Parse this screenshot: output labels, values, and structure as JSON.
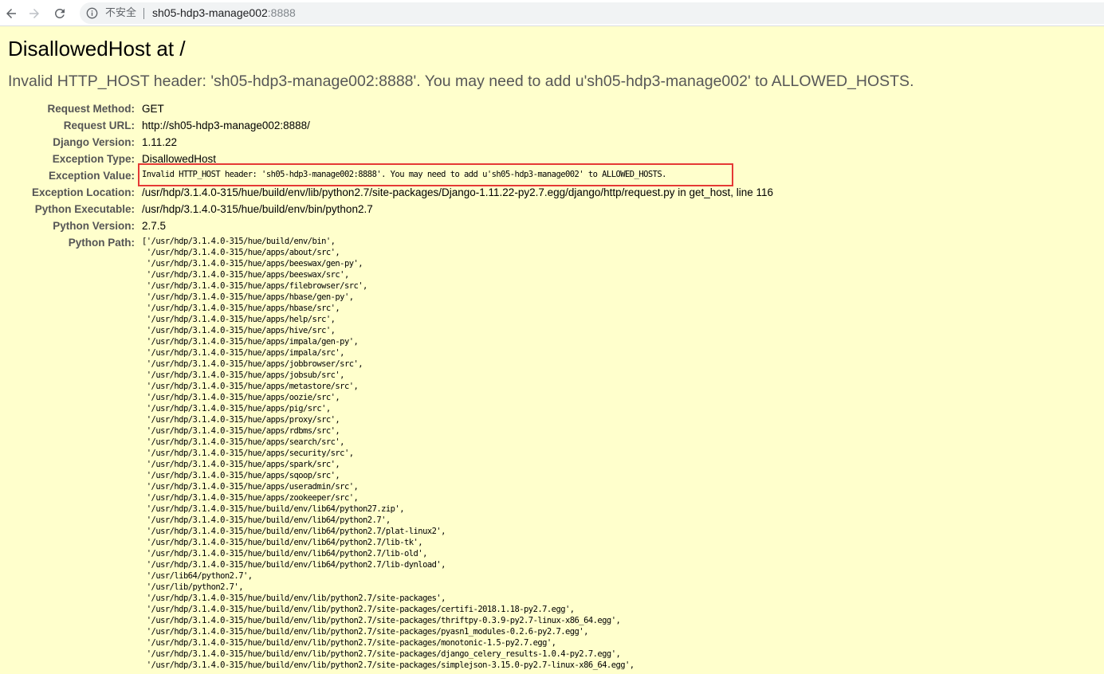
{
  "browser": {
    "insecure_label": "不安全",
    "url_host": "sh05-hdp3-manage002",
    "url_port": ":8888"
  },
  "error": {
    "title": "DisallowedHost at /",
    "subtitle": "Invalid HTTP_HOST header: 'sh05-hdp3-manage002:8888'. You may need to add u'sh05-hdp3-manage002' to ALLOWED_HOSTS."
  },
  "meta": [
    {
      "label": "Request Method:",
      "value": "GET"
    },
    {
      "label": "Request URL:",
      "value": "http://sh05-hdp3-manage002:8888/"
    },
    {
      "label": "Django Version:",
      "value": "1.11.22"
    },
    {
      "label": "Exception Type:",
      "value": "DisallowedHost"
    },
    {
      "label": "Exception Value:",
      "value": "Invalid HTTP_HOST header: 'sh05-hdp3-manage002:8888'. You may need to add u'sh05-hdp3-manage002' to ALLOWED_HOSTS."
    },
    {
      "label": "Exception Location:",
      "value": "/usr/hdp/3.1.4.0-315/hue/build/env/lib/python2.7/site-packages/Django-1.11.22-py2.7.egg/django/http/request.py in get_host, line 116"
    },
    {
      "label": "Python Executable:",
      "value": "/usr/hdp/3.1.4.0-315/hue/build/env/bin/python2.7"
    },
    {
      "label": "Python Version:",
      "value": "2.7.5"
    },
    {
      "label": "Python Path:",
      "value": ""
    }
  ],
  "python_path": [
    "['/usr/hdp/3.1.4.0-315/hue/build/env/bin',",
    " '/usr/hdp/3.1.4.0-315/hue/apps/about/src',",
    " '/usr/hdp/3.1.4.0-315/hue/apps/beeswax/gen-py',",
    " '/usr/hdp/3.1.4.0-315/hue/apps/beeswax/src',",
    " '/usr/hdp/3.1.4.0-315/hue/apps/filebrowser/src',",
    " '/usr/hdp/3.1.4.0-315/hue/apps/hbase/gen-py',",
    " '/usr/hdp/3.1.4.0-315/hue/apps/hbase/src',",
    " '/usr/hdp/3.1.4.0-315/hue/apps/help/src',",
    " '/usr/hdp/3.1.4.0-315/hue/apps/hive/src',",
    " '/usr/hdp/3.1.4.0-315/hue/apps/impala/gen-py',",
    " '/usr/hdp/3.1.4.0-315/hue/apps/impala/src',",
    " '/usr/hdp/3.1.4.0-315/hue/apps/jobbrowser/src',",
    " '/usr/hdp/3.1.4.0-315/hue/apps/jobsub/src',",
    " '/usr/hdp/3.1.4.0-315/hue/apps/metastore/src',",
    " '/usr/hdp/3.1.4.0-315/hue/apps/oozie/src',",
    " '/usr/hdp/3.1.4.0-315/hue/apps/pig/src',",
    " '/usr/hdp/3.1.4.0-315/hue/apps/proxy/src',",
    " '/usr/hdp/3.1.4.0-315/hue/apps/rdbms/src',",
    " '/usr/hdp/3.1.4.0-315/hue/apps/search/src',",
    " '/usr/hdp/3.1.4.0-315/hue/apps/security/src',",
    " '/usr/hdp/3.1.4.0-315/hue/apps/spark/src',",
    " '/usr/hdp/3.1.4.0-315/hue/apps/sqoop/src',",
    " '/usr/hdp/3.1.4.0-315/hue/apps/useradmin/src',",
    " '/usr/hdp/3.1.4.0-315/hue/apps/zookeeper/src',",
    " '/usr/hdp/3.1.4.0-315/hue/build/env/lib64/python27.zip',",
    " '/usr/hdp/3.1.4.0-315/hue/build/env/lib64/python2.7',",
    " '/usr/hdp/3.1.4.0-315/hue/build/env/lib64/python2.7/plat-linux2',",
    " '/usr/hdp/3.1.4.0-315/hue/build/env/lib64/python2.7/lib-tk',",
    " '/usr/hdp/3.1.4.0-315/hue/build/env/lib64/python2.7/lib-old',",
    " '/usr/hdp/3.1.4.0-315/hue/build/env/lib64/python2.7/lib-dynload',",
    " '/usr/lib64/python2.7',",
    " '/usr/lib/python2.7',",
    " '/usr/hdp/3.1.4.0-315/hue/build/env/lib/python2.7/site-packages',",
    " '/usr/hdp/3.1.4.0-315/hue/build/env/lib/python2.7/site-packages/certifi-2018.1.18-py2.7.egg',",
    " '/usr/hdp/3.1.4.0-315/hue/build/env/lib/python2.7/site-packages/thriftpy-0.3.9-py2.7-linux-x86_64.egg',",
    " '/usr/hdp/3.1.4.0-315/hue/build/env/lib/python2.7/site-packages/pyasn1_modules-0.2.6-py2.7.egg',",
    " '/usr/hdp/3.1.4.0-315/hue/build/env/lib/python2.7/site-packages/monotonic-1.5-py2.7.egg',",
    " '/usr/hdp/3.1.4.0-315/hue/build/env/lib/python2.7/site-packages/django_celery_results-1.0.4-py2.7.egg',",
    " '/usr/hdp/3.1.4.0-315/hue/build/env/lib/python2.7/site-packages/simplejson-3.15.0-py2.7-linux-x86_64.egg',"
  ]
}
